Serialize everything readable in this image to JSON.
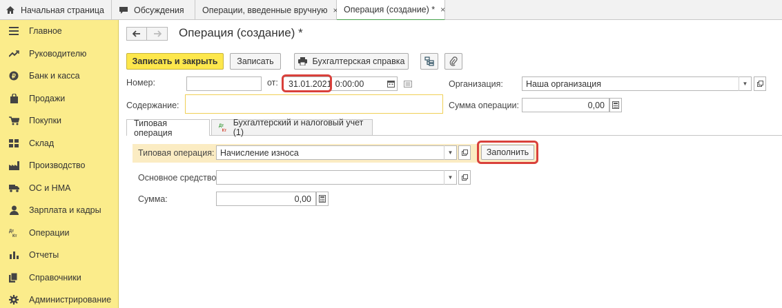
{
  "tabs": [
    {
      "label": "Начальная страница"
    },
    {
      "label": "Обсуждения"
    },
    {
      "label": "Операции, введенные вручную",
      "close": "×"
    },
    {
      "label": "Операция (создание) *",
      "close": "×"
    }
  ],
  "sidebar": {
    "items": [
      {
        "label": "Главное",
        "icon": "menu-icon"
      },
      {
        "label": "Руководителю",
        "icon": "trend-icon"
      },
      {
        "label": "Банк и касса",
        "icon": "coin-icon"
      },
      {
        "label": "Продажи",
        "icon": "bag-icon"
      },
      {
        "label": "Покупки",
        "icon": "cart-icon"
      },
      {
        "label": "Склад",
        "icon": "warehouse-icon"
      },
      {
        "label": "Производство",
        "icon": "factory-icon"
      },
      {
        "label": "ОС и НМА",
        "icon": "truck-icon"
      },
      {
        "label": "Зарплата и кадры",
        "icon": "person-icon"
      },
      {
        "label": "Операции",
        "icon": "dt-kt-icon"
      },
      {
        "label": "Отчеты",
        "icon": "bar-chart-icon"
      },
      {
        "label": "Справочники",
        "icon": "books-icon"
      },
      {
        "label": "Администрирование",
        "icon": "gear-icon"
      }
    ]
  },
  "form": {
    "title": "Операция (создание) *",
    "toolbar": {
      "save_close": "Записать и закрыть",
      "save": "Записать",
      "accounting_ref": "Бухгалтерская справка"
    },
    "number_label": "Номер:",
    "number_value": "",
    "from_label": "от:",
    "date": "31.01.2021",
    "time": "0:00:00",
    "org_label": "Организация:",
    "org_value": "Наша организация",
    "content_label": "Содержание:",
    "content_value": "",
    "sum_op_label": "Сумма операции:",
    "sum_op_value": "0,00",
    "tab_typical": "Типовая операция",
    "tab_accounting": "Бухгалтерский и налоговый учет (1)",
    "typical_label": "Типовая операция:",
    "typical_value": "Начисление износа",
    "fill_button": "Заполнить",
    "asset_label": "Основное средство:",
    "asset_value": "",
    "sum_label": "Сумма:",
    "sum_value": "0,00"
  },
  "colors": {
    "sidebar_bg": "#fbec8b",
    "primary_button": "#fde74c",
    "highlight": "#d9403b",
    "active_tab_underline": "#44a04a",
    "content_border": "#f0cf55"
  }
}
